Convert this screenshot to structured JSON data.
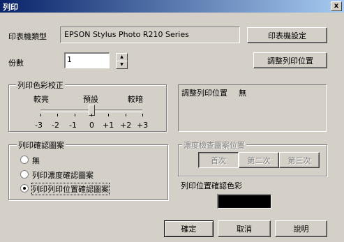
{
  "window": {
    "title": "列印",
    "close_glyph": "x"
  },
  "printer": {
    "label": "印表機類型",
    "value": "EPSON Stylus Photo R210 Series",
    "settings_button": "印表機設定"
  },
  "copies": {
    "label": "份數",
    "value": "1"
  },
  "adjust_button": "調整列印位置",
  "color_correction": {
    "group_title": "列印色彩校正",
    "labels": [
      "較亮",
      "預設",
      "較暗"
    ],
    "scale": [
      "-3",
      "-2",
      "-1",
      "0",
      "+1",
      "+2",
      "+3"
    ],
    "value": 0
  },
  "adjust_info": {
    "label": "調整列印位置",
    "value": "無"
  },
  "confirm_pattern": {
    "group_title": "列印確認圖案",
    "options": [
      "無",
      "列印濃度確認圖案",
      "列印列印位置確認圖案"
    ],
    "selected_index": 2
  },
  "density_position": {
    "group_title": "濃度檢查圖案位置",
    "buttons": [
      "首次",
      "第二次",
      "第三次"
    ]
  },
  "position_color": {
    "label": "列印位置確認色彩",
    "color": "#000000"
  },
  "footer": {
    "ok": "確定",
    "cancel": "取消",
    "help": "說明"
  }
}
